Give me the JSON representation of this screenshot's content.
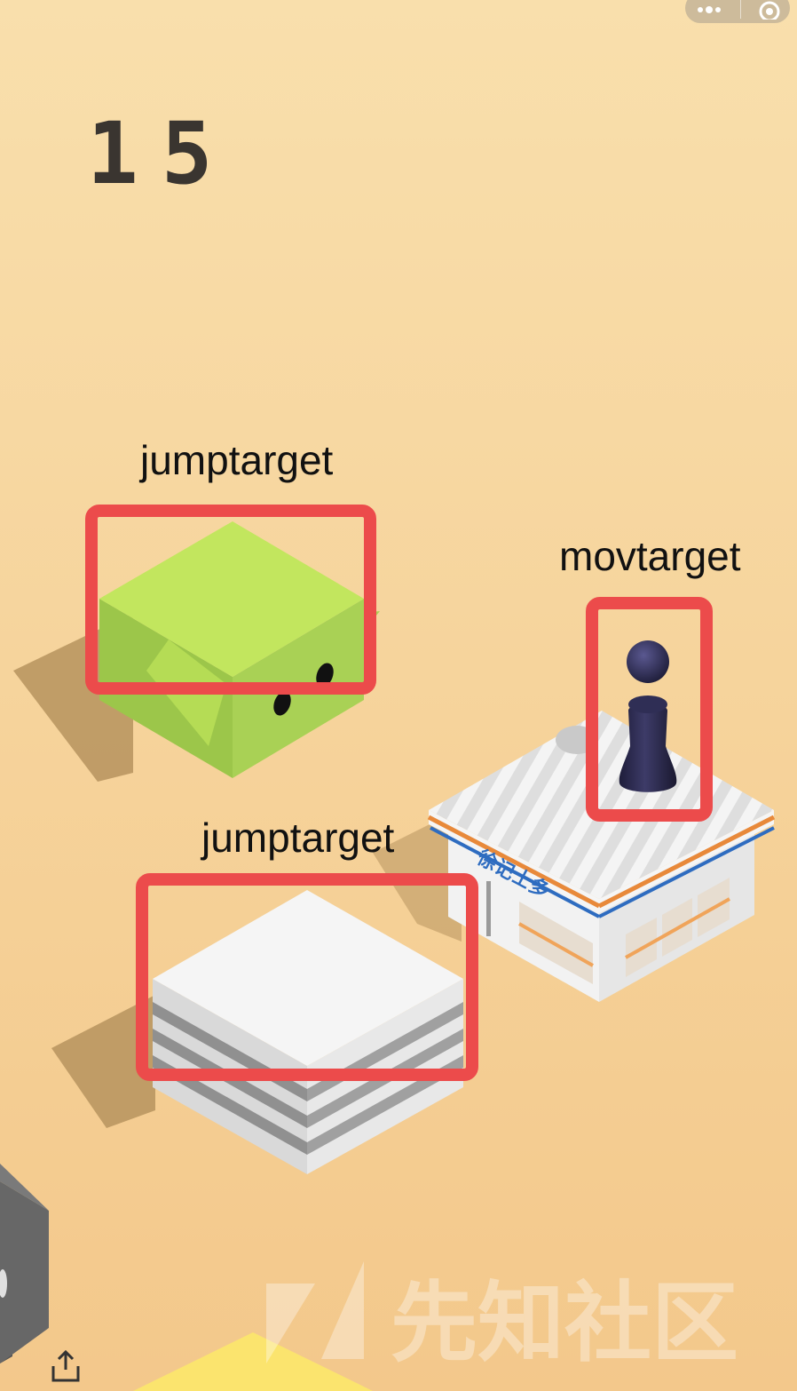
{
  "game": {
    "score": "15"
  },
  "annotations": {
    "jump_label_1": "jumptarget",
    "jump_label_2": "jumptarget",
    "move_label": "movtarget",
    "box_color": "#ec4b4b"
  },
  "scene": {
    "background_top": "#f8deaa",
    "background_bottom": "#f4c98c",
    "green_block_color": "#c2e65e",
    "white_block_color": "#f4f4f4",
    "building_sign": "徐记士多",
    "chess_piece_color": "#2e2c50"
  },
  "watermark": {
    "text": "先知社区"
  },
  "toolbar": {
    "more_icon": "more-dots-icon",
    "close_icon": "target-close-icon",
    "share_icon": "share-icon"
  }
}
